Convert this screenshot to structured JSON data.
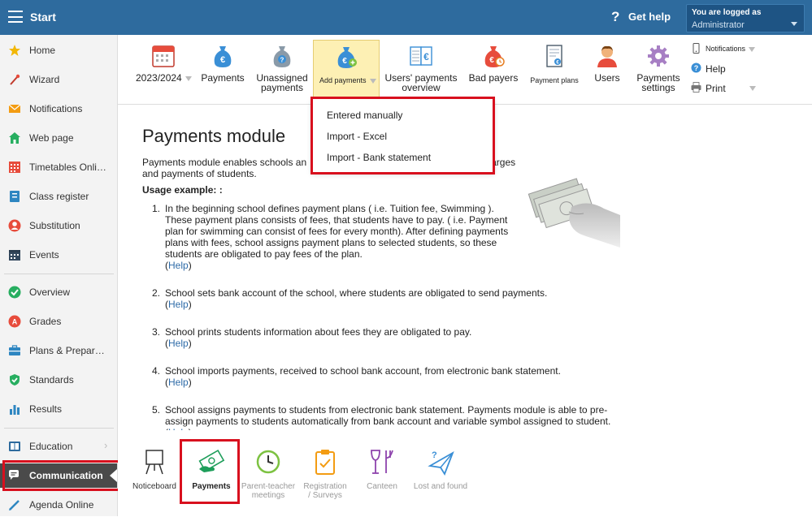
{
  "topbar": {
    "title": "Start",
    "help_label": "Get help",
    "logged_label": "You are logged as",
    "user": "Administrator"
  },
  "sidebar": {
    "items": [
      {
        "label": "Home",
        "icon": "star-icon"
      },
      {
        "label": "Wizard",
        "icon": "wand-icon"
      },
      {
        "label": "Notifications",
        "icon": "envelope-icon"
      },
      {
        "label": "Web page",
        "icon": "house-icon"
      },
      {
        "label": "Timetables Online",
        "icon": "timetable-icon"
      },
      {
        "label": "Class register",
        "icon": "register-icon"
      },
      {
        "label": "Substitution",
        "icon": "person-icon"
      },
      {
        "label": "Events",
        "icon": "calendar-icon"
      },
      {
        "label": "Overview",
        "icon": "check-circle-icon"
      },
      {
        "label": "Grades",
        "icon": "grades-icon"
      },
      {
        "label": "Plans & Preparations",
        "icon": "briefcase-icon"
      },
      {
        "label": "Standards",
        "icon": "shield-check-icon"
      },
      {
        "label": "Results",
        "icon": "bar-chart-icon"
      },
      {
        "label": "Education",
        "icon": "book-icon"
      },
      {
        "label": "Communication",
        "icon": "chat-icon"
      },
      {
        "label": "Agenda Online",
        "icon": "pen-icon"
      }
    ]
  },
  "toolbar": {
    "year": "2023/2024",
    "payments": "Payments",
    "unassigned_1": "Unassigned",
    "unassigned_2": "payments",
    "add_payments": "Add payments",
    "users_overview_1": "Users' payments",
    "users_overview_2": "overview",
    "bad_payers": "Bad payers",
    "payment_plans": "Payment plans",
    "users": "Users",
    "settings_1": "Payments",
    "settings_2": "settings",
    "notifications": "Notifications",
    "help": "Help",
    "print": "Print"
  },
  "dropdown": {
    "items": [
      "Entered manually",
      "Import - Excel",
      "Import - Bank statement"
    ]
  },
  "content": {
    "title": "Payments module",
    "intro": "Payments module enables schools an",
    "intro_tail": "arges",
    "intro_line2": "and payments of students.",
    "usage": "Usage example: :",
    "help_link": "Help",
    "steps": [
      "In the beginning school defines payment plans ( i.e. Tuition fee, Swimming ). These payment plans consists of fees, that students have to pay. ( i.e. Payment plan for swimming can consist of fees for every month). After defining payments plans with fees, school assigns payment plans to selected students, so these students are obligated to pay fees of the plan.",
      "School sets bank account of the school, where students are obligated to send payments.",
      "School prints students information about fees they are obligated to pay.",
      "School imports payments, received to school bank account, from electronic bank statement.",
      "School assigns payments to students from electronic bank statement. Payments module is able to pre-assign payments to students automatically from bank account and variable symbol assigned to student."
    ]
  },
  "bottom": {
    "items": [
      {
        "label": "Noticeboard"
      },
      {
        "label": "Payments"
      },
      {
        "label": "Parent-teacher meetings"
      },
      {
        "label": "Registration / Surveys"
      },
      {
        "label": "Canteen"
      },
      {
        "label": "Lost and found"
      }
    ]
  },
  "colors": {
    "topbar": "#2e6b9e",
    "highlight": "#d8101e",
    "active_tool": "#fdf0b4"
  }
}
